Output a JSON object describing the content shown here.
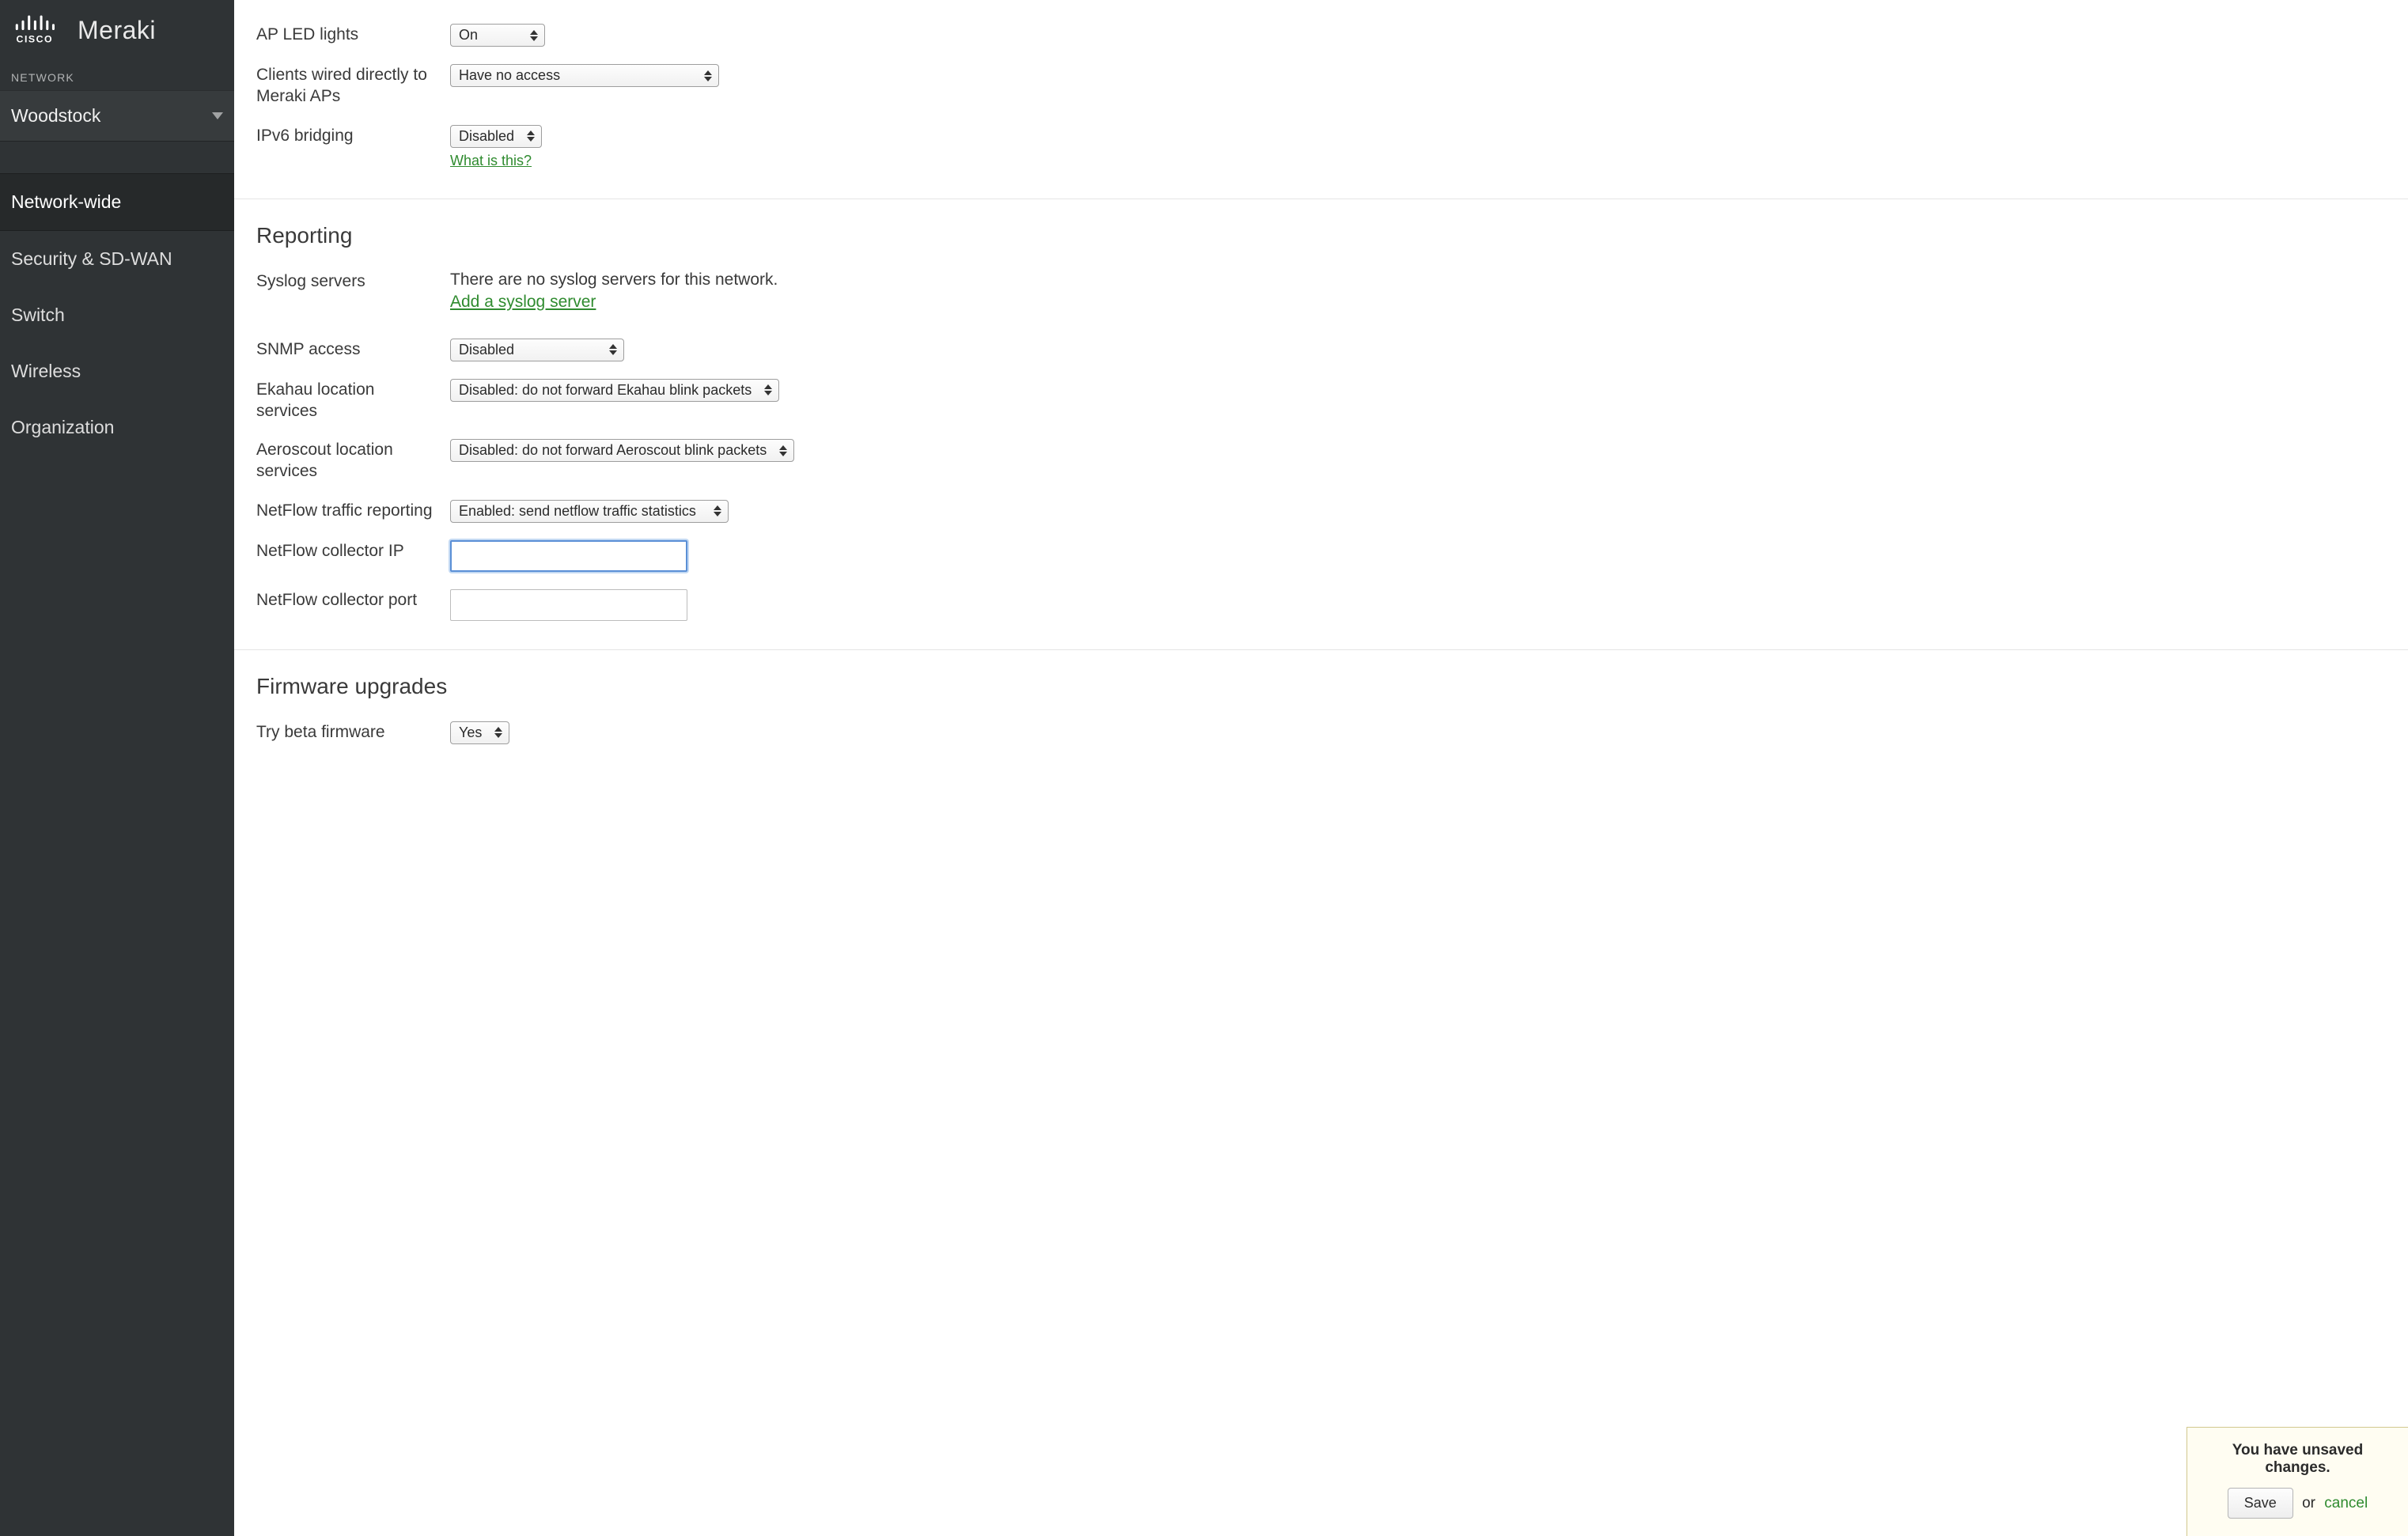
{
  "brand": "Meraki",
  "sidebar": {
    "network_label": "NETWORK",
    "network_name": "Woodstock",
    "items": [
      {
        "label": "Network-wide",
        "active": true
      },
      {
        "label": "Security & SD-WAN",
        "active": false
      },
      {
        "label": "Switch",
        "active": false
      },
      {
        "label": "Wireless",
        "active": false
      },
      {
        "label": "Organization",
        "active": false
      }
    ]
  },
  "top_settings": {
    "ap_led_label": "AP LED lights",
    "ap_led_value": "On",
    "clients_wired_label": "Clients wired directly to Meraki APs",
    "clients_wired_value": "Have no access",
    "ipv6_label": "IPv6 bridging",
    "ipv6_value": "Disabled",
    "ipv6_help": "What is this?"
  },
  "reporting": {
    "heading": "Reporting",
    "syslog_label": "Syslog servers",
    "syslog_text": "There are no syslog servers for this network.",
    "syslog_action": "Add a syslog server",
    "snmp_label": "SNMP access",
    "snmp_value": "Disabled",
    "ekahau_label": "Ekahau location services",
    "ekahau_value": "Disabled: do not forward Ekahau blink packets",
    "aeroscout_label": "Aeroscout location services",
    "aeroscout_value": "Disabled: do not forward Aeroscout blink packets",
    "netflow_label": "NetFlow traffic reporting",
    "netflow_value": "Enabled: send netflow traffic statistics",
    "netflow_ip_label": "NetFlow collector IP",
    "netflow_ip_value": "",
    "netflow_port_label": "NetFlow collector port",
    "netflow_port_value": ""
  },
  "firmware": {
    "heading": "Firmware upgrades",
    "beta_label": "Try beta firmware",
    "beta_value": "Yes"
  },
  "toast": {
    "title": "You have unsaved changes.",
    "save": "Save",
    "or": "or",
    "cancel": "cancel"
  }
}
